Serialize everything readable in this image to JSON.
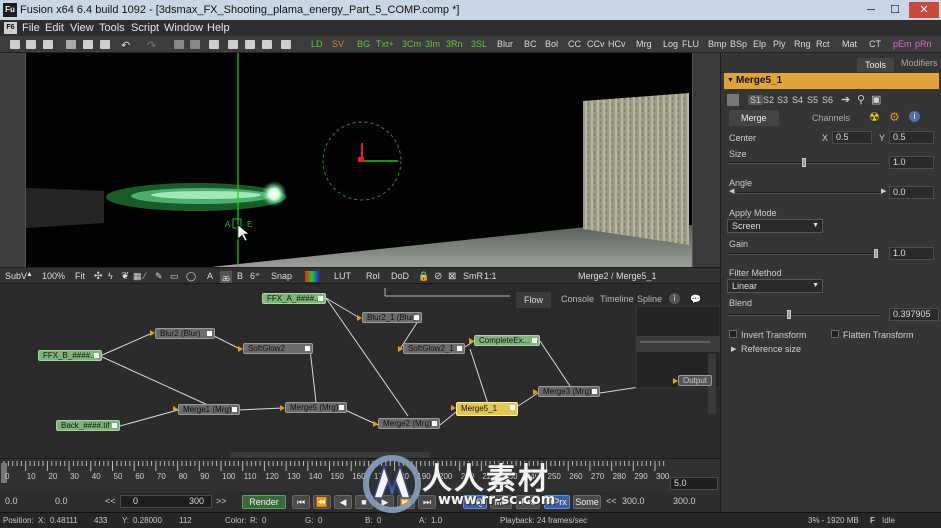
{
  "window": {
    "app_icon": "Fu",
    "title": "Fusion x64 6.4 build 1092 - [3dsmax_FX_Shooting_plama_energy_Part_5_COMP.comp *]",
    "minimize": "─",
    "maximize": "☐",
    "close": "✕"
  },
  "menu": {
    "app_icon": "F6",
    "items": [
      "File",
      "Edit",
      "View",
      "Tools",
      "Script",
      "Window",
      "Help"
    ]
  },
  "toolbar": {
    "tools": [
      "LD",
      "SV",
      "BG",
      "Txt+",
      "3Cm",
      "3Im",
      "3Rn",
      "3SL",
      "Blur",
      "BC",
      "Bol",
      "CC",
      "CCv",
      "HCv",
      "Mrg",
      "Log",
      "FLU",
      "Bmp",
      "BSp",
      "Elp",
      "Ply",
      "Rng",
      "Rct",
      "Mat",
      "CT",
      "pEm",
      "pRn"
    ],
    "green_tools": [
      "LD",
      "SV",
      "BG",
      "Txt+",
      "3Cm",
      "3Im",
      "3Rn",
      "3SL"
    ],
    "pink_tools": [
      "pEm",
      "pRn"
    ]
  },
  "viewer": {
    "overlay_label": "A",
    "overlay_label2": "E"
  },
  "viewer_bar": {
    "view_name": "SubV",
    "zoom": "100%",
    "fit": "Fit",
    "snap": "Snap",
    "lut": "LUT",
    "roi": "RoI",
    "dod": "DoD",
    "smr": "SmR",
    "ratio": "1:1",
    "path": "Merge2 / Merge5_1",
    "a_btn": "A",
    "b_btn": "B"
  },
  "flow": {
    "tabs": [
      "Flow",
      "Console",
      "Timeline",
      "Spline"
    ],
    "active_tab": "Flow",
    "nodes": {
      "ffx_a": "FFX_A_####...",
      "blur2": "Blur2 (Blur)",
      "blur2_1": "Blur2_1 (Blur)",
      "ffx_b": "FFX_B_####...",
      "softglow2": "SoftGlow2",
      "softglow2_1": "SoftGlow2_1",
      "complete": "CompleteEx...",
      "merge1": "Merge1 (Mrg)",
      "merge5": "Merge5 (Mrg)",
      "merge5_1": "Merge5_1",
      "merge3": "Merge3 (Mrg)",
      "merge2": "Merge2 (Mrg)",
      "back": "Back_####.tif",
      "output": "Output"
    }
  },
  "timeline": {
    "ticks": [
      "0",
      "10",
      "20",
      "30",
      "40",
      "50",
      "60",
      "70",
      "80",
      "90",
      "100",
      "110",
      "120",
      "130",
      "140",
      "150",
      "160",
      "170",
      "180",
      "190",
      "200",
      "210",
      "220",
      "230",
      "240",
      "250",
      "260",
      "270",
      "280",
      "290",
      "300"
    ],
    "current": "5.0"
  },
  "controls": {
    "start": "0.0",
    "global_start": "0.0",
    "range_start": "0",
    "range_end": "300",
    "render": "Render",
    "hiq": "HiQ",
    "mb": "MB",
    "prx": "Prx",
    "aprx": "APrx",
    "some": "Some",
    "end": "300.0",
    "global_end": "300.0",
    "prev_marker": "<<",
    "next_marker": ">>"
  },
  "statusbar": {
    "position_label": "Position:",
    "x_label": "X:",
    "x_value": "0.48111",
    "x_px": "433",
    "y_label": "Y:",
    "y_value": "0.28000",
    "y_px": "112",
    "color_label": "Color:",
    "r_label": "R:",
    "r_value": "0",
    "g_label": "G:",
    "g_value": "0",
    "b_label": "B:",
    "b_value": "0",
    "a_label": "A:",
    "a_value": "1.0",
    "playback": "Playback: 24 frames/sec",
    "memory": "3% - 1920 MB",
    "state": "Idle",
    "state_icon": "F"
  },
  "panel": {
    "tabs": [
      "Tools",
      "Modifiers"
    ],
    "active_tab": "Tools",
    "node_name": "Merge5_1",
    "slots": [
      "S1",
      "S2",
      "S3",
      "S4",
      "S5",
      "S6"
    ],
    "sub_tabs": [
      "Merge",
      "Channels"
    ],
    "center_label": "Center",
    "center_x_label": "X",
    "center_x": "0.5",
    "center_y_label": "Y",
    "center_y": "0.5",
    "size_label": "Size",
    "size_value": "1.0",
    "angle_label": "Angle",
    "angle_value": "0.0",
    "apply_mode_label": "Apply Mode",
    "apply_mode": "Screen",
    "gain_label": "Gain",
    "gain_value": "1.0",
    "filter_label": "Filter Method",
    "filter_value": "Linear",
    "blend_label": "Blend",
    "blend_value": "0.397905",
    "invert_label": "Invert Transform",
    "flatten_label": "Flatten Transform",
    "reference_label": "Reference size",
    "size_level": 0.5,
    "gain_level": 1.0,
    "blend_level": 0.4
  },
  "watermark": {
    "cn_text": "人人素材",
    "url": "www.rr-sc.com"
  }
}
